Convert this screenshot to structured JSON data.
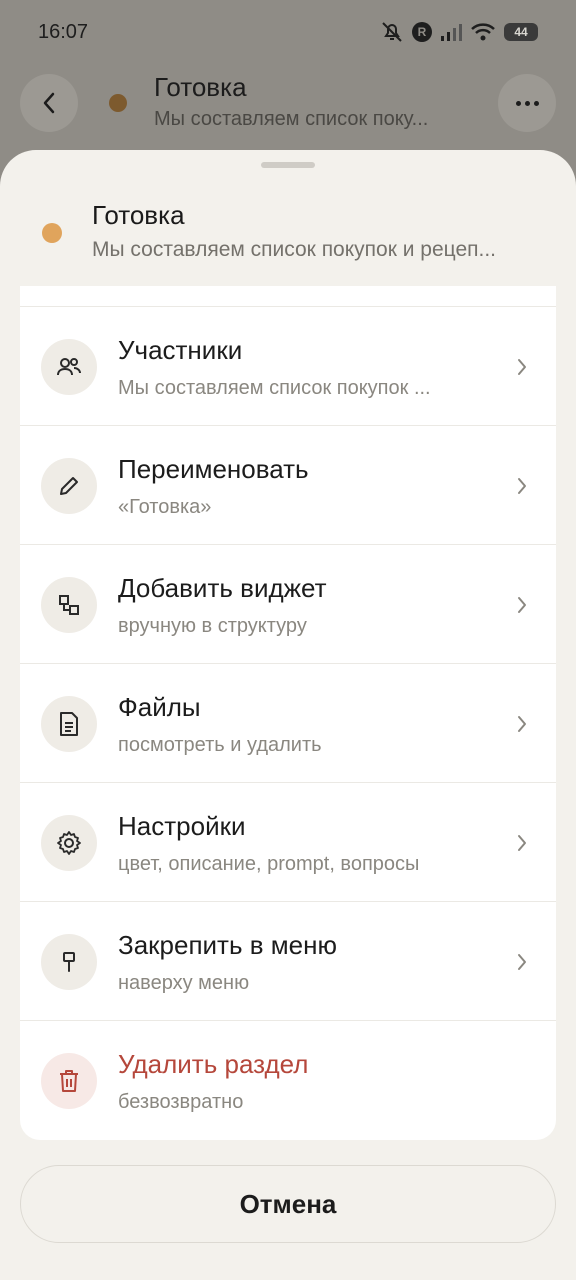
{
  "status_bar": {
    "time": "16:07",
    "badge_letter": "R",
    "battery": "44"
  },
  "chat_header": {
    "title": "Готовка",
    "subtitle": "Мы составляем список поку...",
    "dot_color": "#7d5a2e"
  },
  "sheet": {
    "title": "Готовка",
    "subtitle": "Мы составляем список покупок и рецеп...",
    "dot_color": "#e0a45c",
    "items": [
      {
        "icon": "people-icon",
        "title": "Участники",
        "subtitle": "Мы составляем список покупок ..."
      },
      {
        "icon": "pencil-icon",
        "title": "Переименовать",
        "subtitle": "«Готовка»"
      },
      {
        "icon": "widget-icon",
        "title": "Добавить виджет",
        "subtitle": "вручную в структуру"
      },
      {
        "icon": "file-icon",
        "title": "Файлы",
        "subtitle": "посмотреть и удалить"
      },
      {
        "icon": "gear-icon",
        "title": "Настройки",
        "subtitle": "цвет, описание, prompt, вопросы"
      },
      {
        "icon": "pin-icon",
        "title": "Закрепить в меню",
        "subtitle": "наверху меню"
      },
      {
        "icon": "trash-icon",
        "title": "Удалить раздел",
        "subtitle": "безвозвратно",
        "danger": true,
        "danger_color": "#b5473b"
      }
    ],
    "cancel_label": "Отмена"
  }
}
